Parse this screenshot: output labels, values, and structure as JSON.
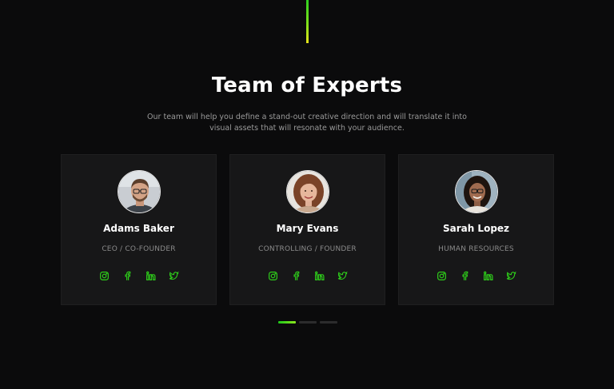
{
  "section": {
    "title": "Team of Experts",
    "subtitle": "Our team will help you define a stand-out creative direction and will translate it into visual assets that will resonate with your audience."
  },
  "team": [
    {
      "name": "Adams Baker",
      "role": "CEO / CO-FOUNDER",
      "socials": [
        "instagram-icon",
        "facebook-icon",
        "linkedin-icon",
        "twitter-icon"
      ]
    },
    {
      "name": "Mary Evans",
      "role": "CONTROLLING / FOUNDER",
      "socials": [
        "instagram-icon",
        "facebook-icon",
        "linkedin-icon",
        "twitter-icon"
      ]
    },
    {
      "name": "Sarah Lopez",
      "role": "HUMAN RESOURCES",
      "socials": [
        "instagram-icon",
        "facebook-icon",
        "linkedin-icon",
        "twitter-icon"
      ]
    }
  ],
  "pagination": {
    "total": 3,
    "active": 1
  },
  "colors": {
    "background": "#0b0b0c",
    "card": "#171718",
    "accent": "#2ecc1a",
    "text": "#ffffff",
    "muted": "#8a8a8a"
  }
}
